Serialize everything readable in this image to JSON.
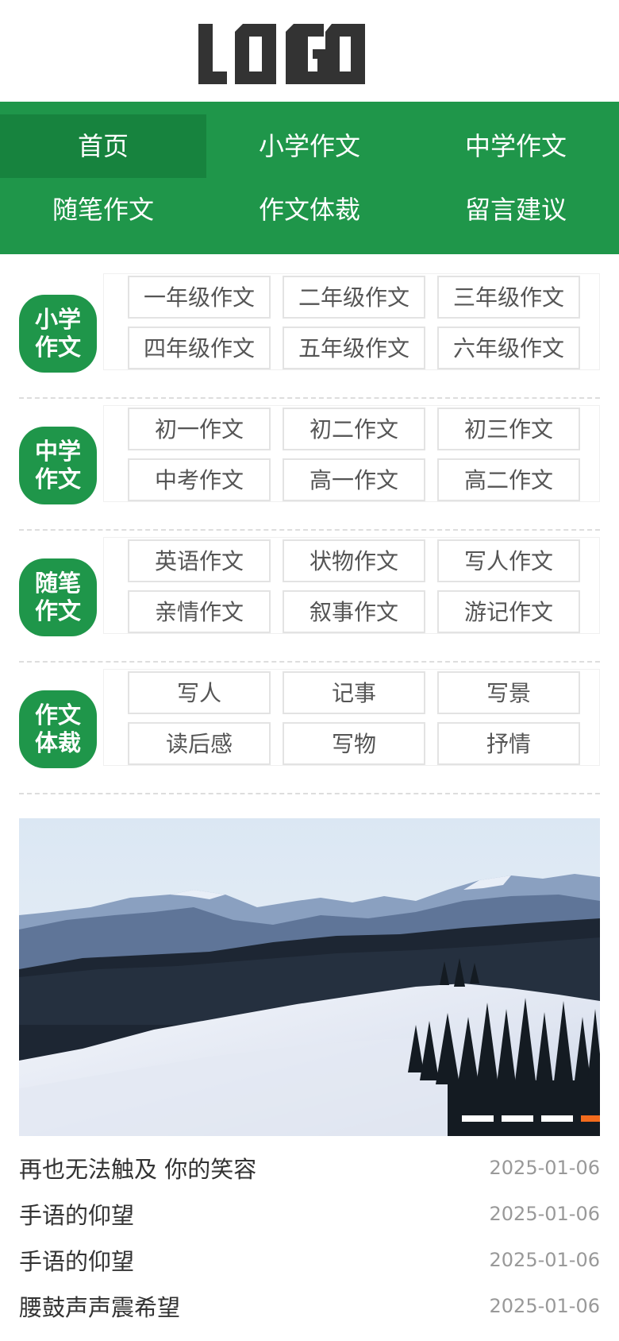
{
  "logo_text": "LOGO",
  "colors": {
    "primary": "#1f964a",
    "primary_dark": "#17833e",
    "accent": "#f26b1d"
  },
  "nav": [
    {
      "label": "首页",
      "active": true
    },
    {
      "label": "小学作文"
    },
    {
      "label": "中学作文"
    },
    {
      "label": "随笔作文"
    },
    {
      "label": "作文体裁"
    },
    {
      "label": "留言建议"
    }
  ],
  "categories": [
    {
      "line1": "小学",
      "line2": "作文",
      "links": [
        "一年级作文",
        "二年级作文",
        "三年级作文",
        "四年级作文",
        "五年级作文",
        "六年级作文"
      ]
    },
    {
      "line1": "中学",
      "line2": "作文",
      "links": [
        "初一作文",
        "初二作文",
        "初三作文",
        "中考作文",
        "高一作文",
        "高二作文"
      ]
    },
    {
      "line1": "随笔",
      "line2": "作文",
      "links": [
        "英语作文",
        "状物作文",
        "写人作文",
        "亲情作文",
        "叙事作文",
        "游记作文"
      ]
    },
    {
      "line1": "作文",
      "line2": "体裁",
      "links": [
        "写人",
        "记事",
        "写景",
        "读后感",
        "写物",
        "抒情"
      ]
    }
  ],
  "banner": {
    "slides": 4,
    "active_slide": 4
  },
  "articles": [
    {
      "title": "再也无法触及 你的笑容",
      "date": "2025-01-06"
    },
    {
      "title": "手语的仰望",
      "date": "2025-01-06"
    },
    {
      "title": "手语的仰望",
      "date": "2025-01-06"
    },
    {
      "title": "腰鼓声声震希望",
      "date": "2025-01-06"
    }
  ]
}
